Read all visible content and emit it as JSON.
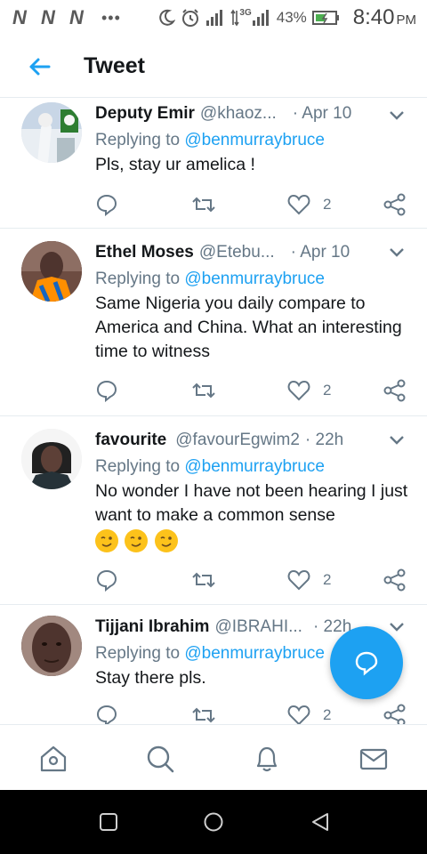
{
  "status_bar": {
    "carrier_logos": [
      "N",
      "N",
      "N"
    ],
    "dots": "•••",
    "network_type": "3G",
    "battery_percent": "43%",
    "time": "8:40",
    "ampm": "PM"
  },
  "header": {
    "title": "Tweet",
    "back_icon": "back-arrow-icon"
  },
  "tweets": [
    {
      "name": "Deputy Emir",
      "handle": "@khaoz...",
      "date": "· Apr 10",
      "replying_prefix": "Replying to",
      "replying_to": "@benmurraybruce",
      "text": "Pls, stay ur amelica !",
      "likes": "2"
    },
    {
      "name": "Ethel Moses",
      "handle": "@Etebu...",
      "date": "· Apr 10",
      "replying_prefix": "Replying to",
      "replying_to": "@benmurraybruce",
      "text": "Same Nigeria you daily compare to America and China. What an interesting time to witness",
      "likes": "2"
    },
    {
      "name": "favourite",
      "handle": "@favourEgwim2",
      "date": "· 22h",
      "replying_prefix": "Replying to",
      "replying_to": "@benmurraybruce",
      "text": "No wonder I have not been hearing I just want to make a common sense",
      "emoji_count": 3,
      "likes": "2"
    },
    {
      "name": "Tijjani Ibrahim",
      "handle": "@IBRAHI...",
      "date": "· 22h",
      "replying_prefix": "Replying to",
      "replying_to": "@benmurraybruce",
      "text": "Stay there pls.",
      "likes": "2"
    }
  ],
  "fab": {
    "icon": "compose-reply-icon"
  },
  "bottom_tabs": [
    "home-icon",
    "search-icon",
    "notifications-icon",
    "messages-icon"
  ],
  "android_nav": [
    "recents-square-icon",
    "home-circle-icon",
    "back-triangle-icon"
  ],
  "colors": {
    "accent": "#1da1f2",
    "text_primary": "#14171a",
    "text_secondary": "#657786",
    "divider": "#e6ecf0"
  }
}
